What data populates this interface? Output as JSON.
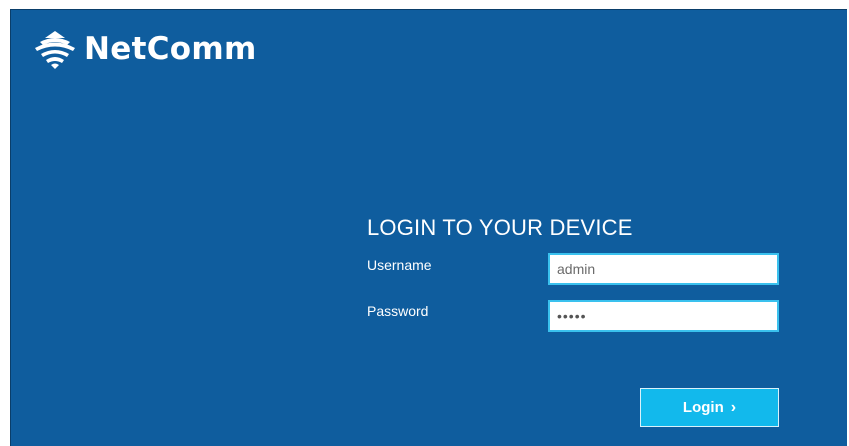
{
  "brand": {
    "name": "NetComm",
    "accent_color": "#0f5d9e",
    "icon": "wifi-logo-icon"
  },
  "login": {
    "title": "LOGIN TO YOUR DEVICE",
    "username_label": "Username",
    "username_value": "admin",
    "password_label": "Password",
    "password_value": "•••••",
    "button_label": "Login",
    "button_icon": "chevron-right-icon",
    "button_color": "#12b9ec",
    "field_border_color": "#3ac1ee"
  }
}
